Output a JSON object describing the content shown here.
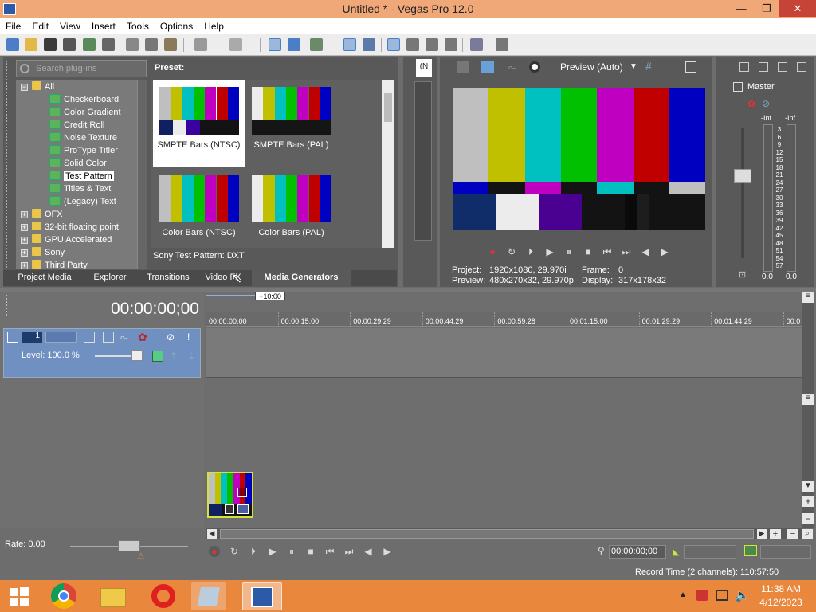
{
  "window": {
    "title": "Untitled * - Vegas Pro 12.0",
    "min": "—",
    "max": "❐",
    "close": "✕"
  },
  "menu": [
    "File",
    "Edit",
    "View",
    "Insert",
    "Tools",
    "Options",
    "Help"
  ],
  "plugins": {
    "search_placeholder": "Search plug-ins",
    "tree": [
      {
        "label": "All",
        "type": "folder",
        "expanded": true
      },
      {
        "label": "Checkerboard",
        "type": "plugin"
      },
      {
        "label": "Color Gradient",
        "type": "plugin"
      },
      {
        "label": "Credit Roll",
        "type": "plugin"
      },
      {
        "label": "Noise Texture",
        "type": "plugin"
      },
      {
        "label": "ProType Titler",
        "type": "plugin"
      },
      {
        "label": "Solid Color",
        "type": "plugin"
      },
      {
        "label": "Test Pattern",
        "type": "plugin",
        "selected": true
      },
      {
        "label": "Titles & Text",
        "type": "plugin"
      },
      {
        "label": "(Legacy) Text",
        "type": "plugin"
      },
      {
        "label": "OFX",
        "type": "folder"
      },
      {
        "label": "32-bit floating point",
        "type": "folder"
      },
      {
        "label": "GPU Accelerated",
        "type": "folder"
      },
      {
        "label": "Sony",
        "type": "folder"
      },
      {
        "label": "Third Party",
        "type": "folder"
      }
    ],
    "preset_heading": "Preset:",
    "presets": [
      {
        "label": "SMPTE Bars (NTSC)",
        "selected": true
      },
      {
        "label": "SMPTE Bars (PAL)"
      },
      {
        "label": "Color Bars (NTSC)"
      },
      {
        "label": "Color Bars (PAL)"
      }
    ],
    "description": "Sony Test Pattern: DXT"
  },
  "tabs": [
    {
      "label": "Project Media"
    },
    {
      "label": "Explorer"
    },
    {
      "label": "Transitions"
    },
    {
      "label": "Video FX"
    },
    {
      "label": "Media Generators",
      "active": true
    }
  ],
  "trimmer": {
    "label": "(N"
  },
  "preview": {
    "mode": "Preview (Auto)",
    "project_label": "Project:",
    "project_value": "1920x1080, 29.970i",
    "preview_label": "Preview:",
    "preview_value": "480x270x32, 29.970p",
    "frame_label": "Frame:",
    "frame_value": "0",
    "display_label": "Display:",
    "display_value": "317x178x32"
  },
  "master": {
    "label": "Master",
    "left_peak": "-Inf.",
    "right_peak": "-Inf.",
    "scale": [
      "3",
      "6",
      "9",
      "12",
      "15",
      "18",
      "21",
      "24",
      "27",
      "30",
      "33",
      "36",
      "39",
      "42",
      "45",
      "48",
      "51",
      "54",
      "57"
    ],
    "left_level": "0.0",
    "right_level": "0.0"
  },
  "timeline": {
    "time": "00:00:00;00",
    "marker": "+10:00",
    "ruler": [
      "00:00:00;00",
      "00:00:15:00",
      "00:00:29:29",
      "00:00:44:29",
      "00:00:59:28",
      "00:01:15:00",
      "00:01:29:29",
      "00:01:44:29",
      "00:0"
    ],
    "track_number": "1",
    "track_level": "Level: 100.0 %",
    "rate": "Rate: 0.00",
    "cursor_time": "00:00:00;00",
    "record_time": "Record Time (2 channels): 110:57:50"
  },
  "taskbar": {
    "time": "11:38 AM",
    "date": "4/12/2023",
    "tray_arrow": "▲"
  },
  "colors": {
    "titlebar": "#f0a878",
    "taskbar": "#e9873c",
    "panel": "#595959",
    "selection": "#ffffff"
  }
}
